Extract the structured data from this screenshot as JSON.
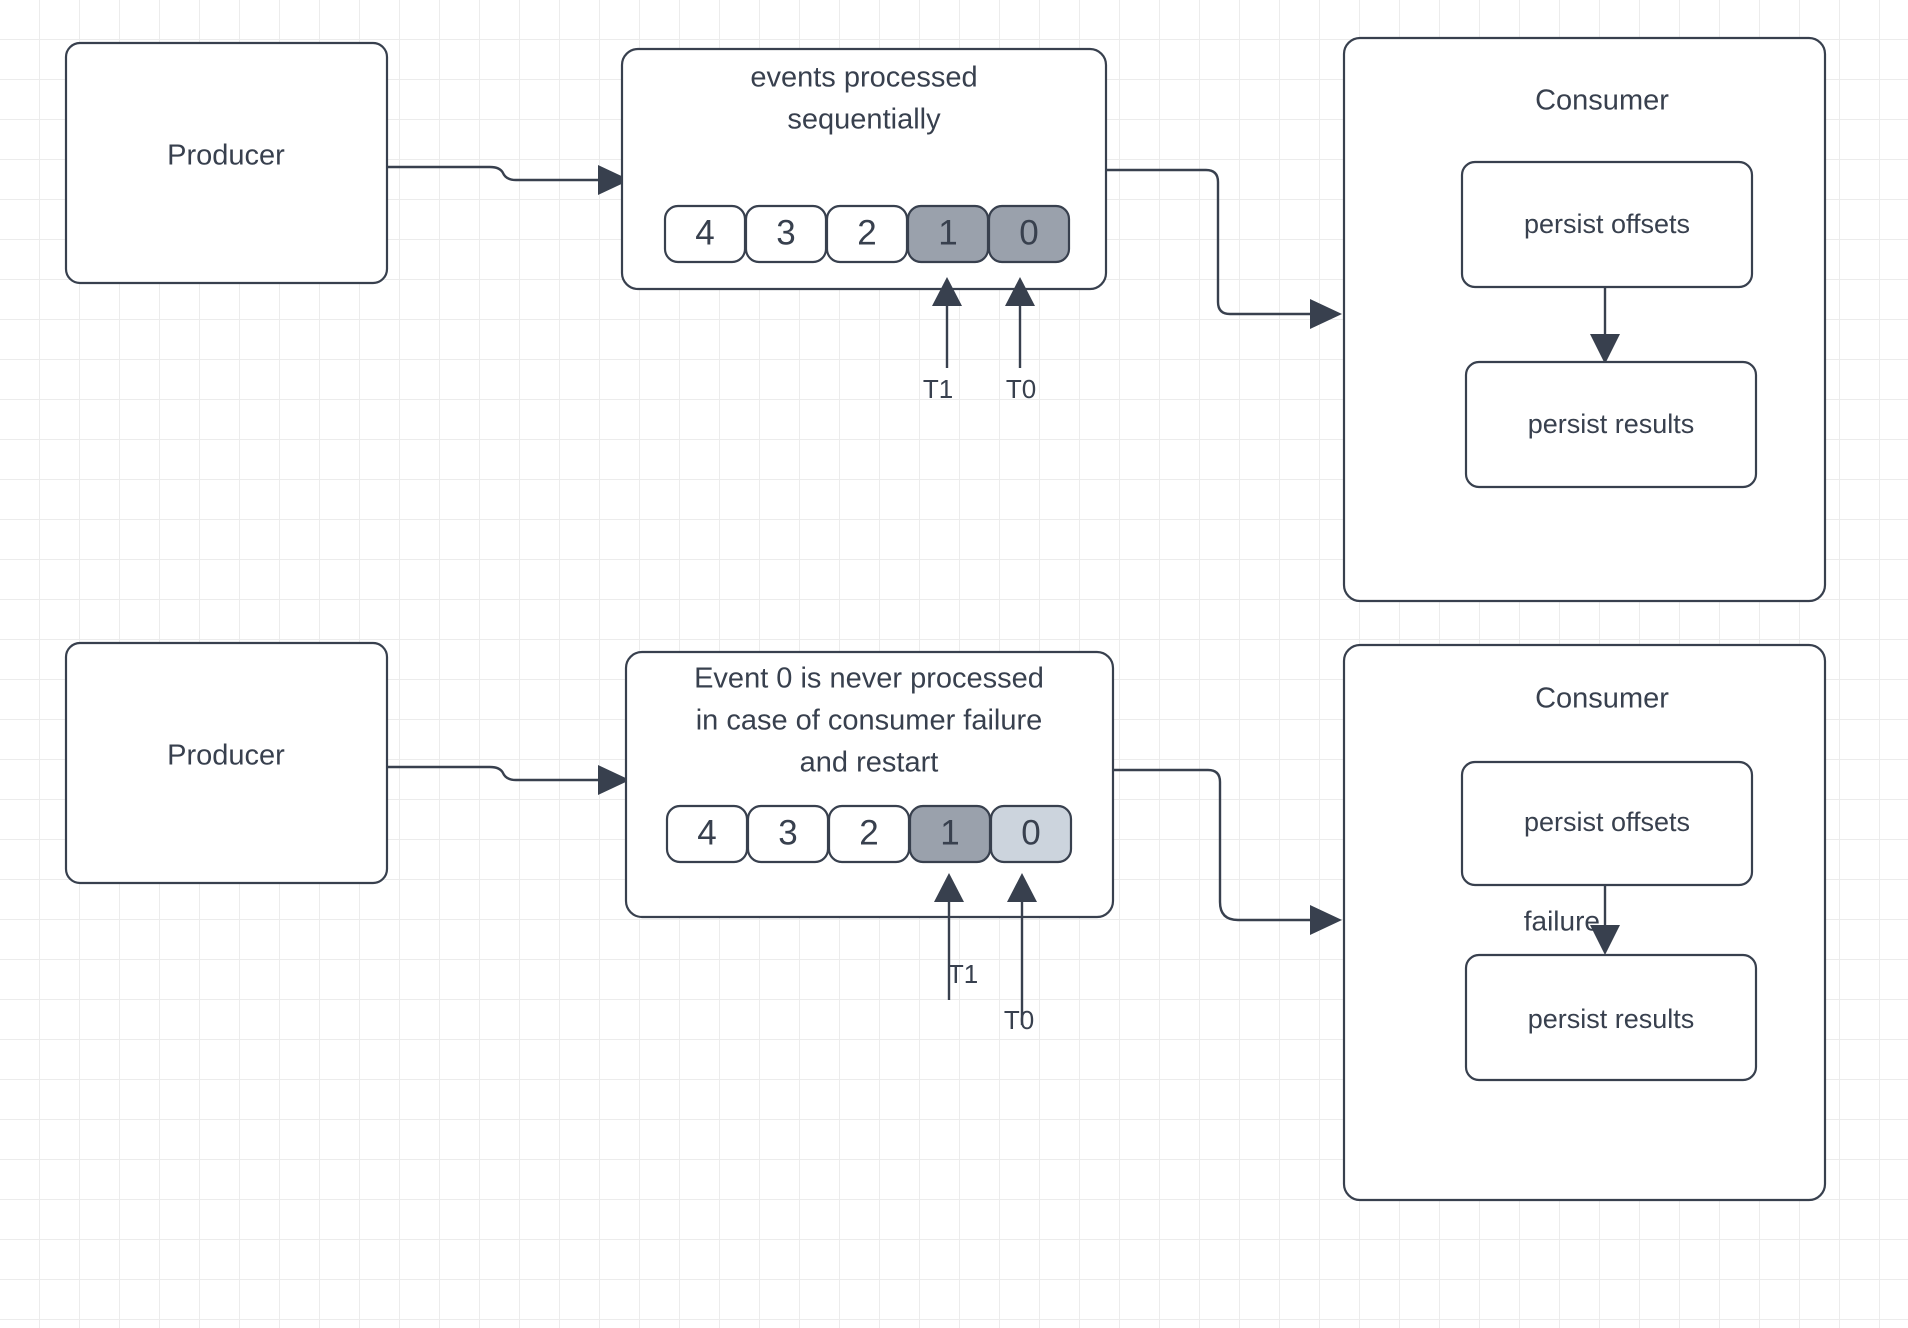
{
  "diagram": {
    "title": "kafka consumer offset commit diagram",
    "colors": {
      "stroke": "#38404e",
      "text": "#38404e",
      "node_fill": "#ffffff",
      "event_processed_fill": "#9aa1ac",
      "event_skipped_fill": "#ccd4dd",
      "grid_minor": "#ececec",
      "grid_major": "#e0e0e0",
      "background": "#ffffff"
    },
    "rows": [
      {
        "id": "row-success",
        "producer": {
          "label": "Producer"
        },
        "stream": {
          "caption_lines": [
            "events processed",
            "sequentially"
          ],
          "events": [
            {
              "label": "4",
              "state": "pending"
            },
            {
              "label": "3",
              "state": "pending"
            },
            {
              "label": "2",
              "state": "pending"
            },
            {
              "label": "1",
              "state": "processed"
            },
            {
              "label": "0",
              "state": "processed"
            }
          ],
          "ticks": [
            {
              "label": "T1",
              "target_event": "1"
            },
            {
              "label": "T0",
              "target_event": "0"
            }
          ]
        },
        "consumer": {
          "title": "Consumer",
          "steps": [
            {
              "label": "persist offsets"
            },
            {
              "label": "persist results"
            }
          ],
          "step_edge_label": ""
        }
      },
      {
        "id": "row-failure",
        "producer": {
          "label": "Producer"
        },
        "stream": {
          "caption_lines": [
            "Event 0 is never processed",
            "in case of consumer failure",
            "and restart"
          ],
          "events": [
            {
              "label": "4",
              "state": "pending"
            },
            {
              "label": "3",
              "state": "pending"
            },
            {
              "label": "2",
              "state": "pending"
            },
            {
              "label": "1",
              "state": "processed"
            },
            {
              "label": "0",
              "state": "skipped"
            }
          ],
          "ticks": [
            {
              "label": "T1",
              "target_event": "1"
            },
            {
              "label": "T0",
              "target_event": "0"
            }
          ]
        },
        "consumer": {
          "title": "Consumer",
          "steps": [
            {
              "label": "persist offsets"
            },
            {
              "label": "persist results"
            }
          ],
          "step_edge_label": "failure"
        }
      }
    ]
  }
}
